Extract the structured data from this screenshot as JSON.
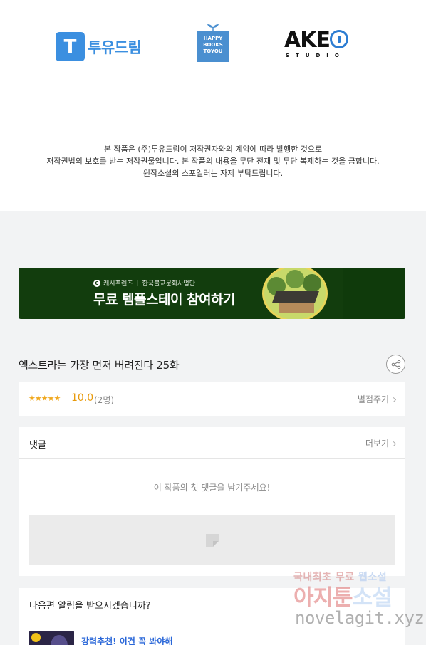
{
  "publisher_logos": {
    "tudream": {
      "mark": "T",
      "name": "투유드림"
    },
    "happybooks": {
      "lines": [
        "HAPPY",
        "BOOKS",
        "TOYOU"
      ]
    },
    "akeo": {
      "name": "AKE",
      "sub": "STUDIO"
    }
  },
  "copyright_notice": {
    "line1": "본 작품은 (주)투유드림이 저작권자와의 계약에 따라 발행한 것으로",
    "line2": "저작권법의 보호를 받는 저작권물입니다. 본 작품의 내용을 무단 전재 및 무단 복제하는 것을 금합니다.",
    "line3": "원작소설의 스포일러는 자제 부탁드립니다."
  },
  "ad_banner": {
    "sponsor": "캐시프렌즈",
    "partner": "한국불교문화사업단",
    "headline": "무료 템플스테이 참여하기",
    "colors": {
      "background": "#123d0d"
    }
  },
  "episode": {
    "title": "엑스트라는 가장 먼저 버려진다 25화"
  },
  "rating": {
    "stars": "★★★★★",
    "score": "10.0",
    "count": "(2명)",
    "rate_label": "별점주기"
  },
  "comments": {
    "title": "댓글",
    "more_label": "더보기",
    "empty_message": "이 작품의 첫 댓글을 남겨주세요!"
  },
  "next_alert": {
    "question": "다음편 알림을 받으시겠습니까?",
    "recommend": "강력추천! 이건 꼭 봐야해"
  },
  "watermark": {
    "line1_a": "국내최초 무료 ",
    "line1_b": "웹소설",
    "line2_a": "아지툰",
    "line2_b": "소설",
    "line3": "novelagit.xyz"
  },
  "colors": {
    "accent_blue": "#3b8fe0",
    "star": "#f0a81e",
    "score": "#e89a0c"
  }
}
